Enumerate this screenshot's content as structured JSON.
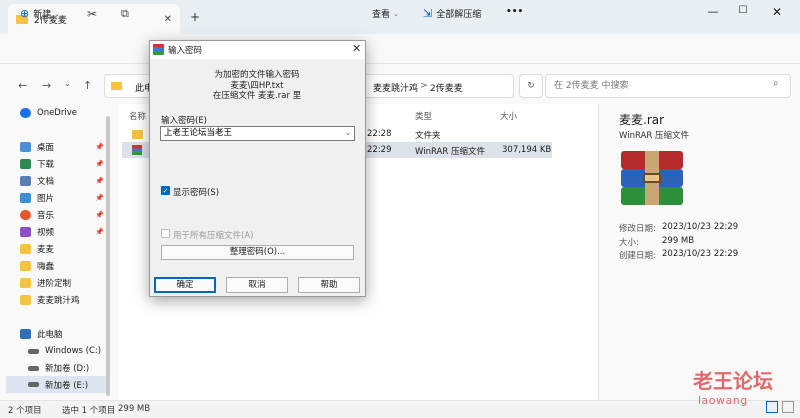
{
  "tab": {
    "title": "2传麦麦",
    "new_tab": "+"
  },
  "window": {
    "min": "—",
    "max": "☐",
    "close": "✕"
  },
  "cmdbar": {
    "new": "新建",
    "view": "查看",
    "extract_all": "全部解压缩",
    "more": "•••"
  },
  "address": {
    "crumb1": "此电",
    "crumb2": "麦麦跳汁鸡",
    "sep": ">",
    "crumb3": "2传麦麦",
    "search_placeholder": "在 2传麦麦 中搜索"
  },
  "sidebar": {
    "onedrive": "OneDrive",
    "items": [
      "桌面",
      "下载",
      "文档",
      "图片",
      "音乐",
      "视频",
      "麦麦",
      "嗨蠢",
      "进阶定制",
      "麦麦跳汁鸡"
    ],
    "this_pc": "此电脑",
    "drives": [
      "Windows (C:)",
      "新加卷 (D:)",
      "新加卷 (E:)"
    ]
  },
  "filelist": {
    "col_name": "名称",
    "col_type": "类型",
    "col_size": "大小",
    "rows": [
      {
        "date": "22:28",
        "type": "文件夹",
        "size": ""
      },
      {
        "date": "22:29",
        "type": "WinRAR 压缩文件",
        "size": "307,194 KB"
      }
    ]
  },
  "details": {
    "title": "麦麦.rar",
    "type": "WinRAR 压缩文件",
    "modified_label": "修改日期:",
    "modified": "2023/10/23 22:29",
    "size_label": "大小:",
    "size": "299 MB",
    "created_label": "创建日期:",
    "created": "2023/10/23 22:29"
  },
  "status": {
    "count": "2 个项目",
    "selected": "选中 1 个项目",
    "sel_size": "299 MB"
  },
  "dialog": {
    "title": "输入密码",
    "line1": "为加密的文件输入密码",
    "line2": "麦麦\\四HP.txt",
    "line3": "在压缩文件 麦麦.rar 里",
    "pw_label": "输入密码(E)",
    "pw_value": "上老王论坛当老王",
    "show_pw": "显示密码(S)",
    "use_all": "用于所有压缩文件(A)",
    "manage": "整理密码(O)...",
    "ok": "确定",
    "cancel": "取消",
    "help": "帮助"
  },
  "watermark": {
    "cn": "老王论坛",
    "en": "laowang"
  },
  "colors": {
    "accent": "#0067c0",
    "folder": "#f5c242",
    "watermark": "#e0686a"
  }
}
